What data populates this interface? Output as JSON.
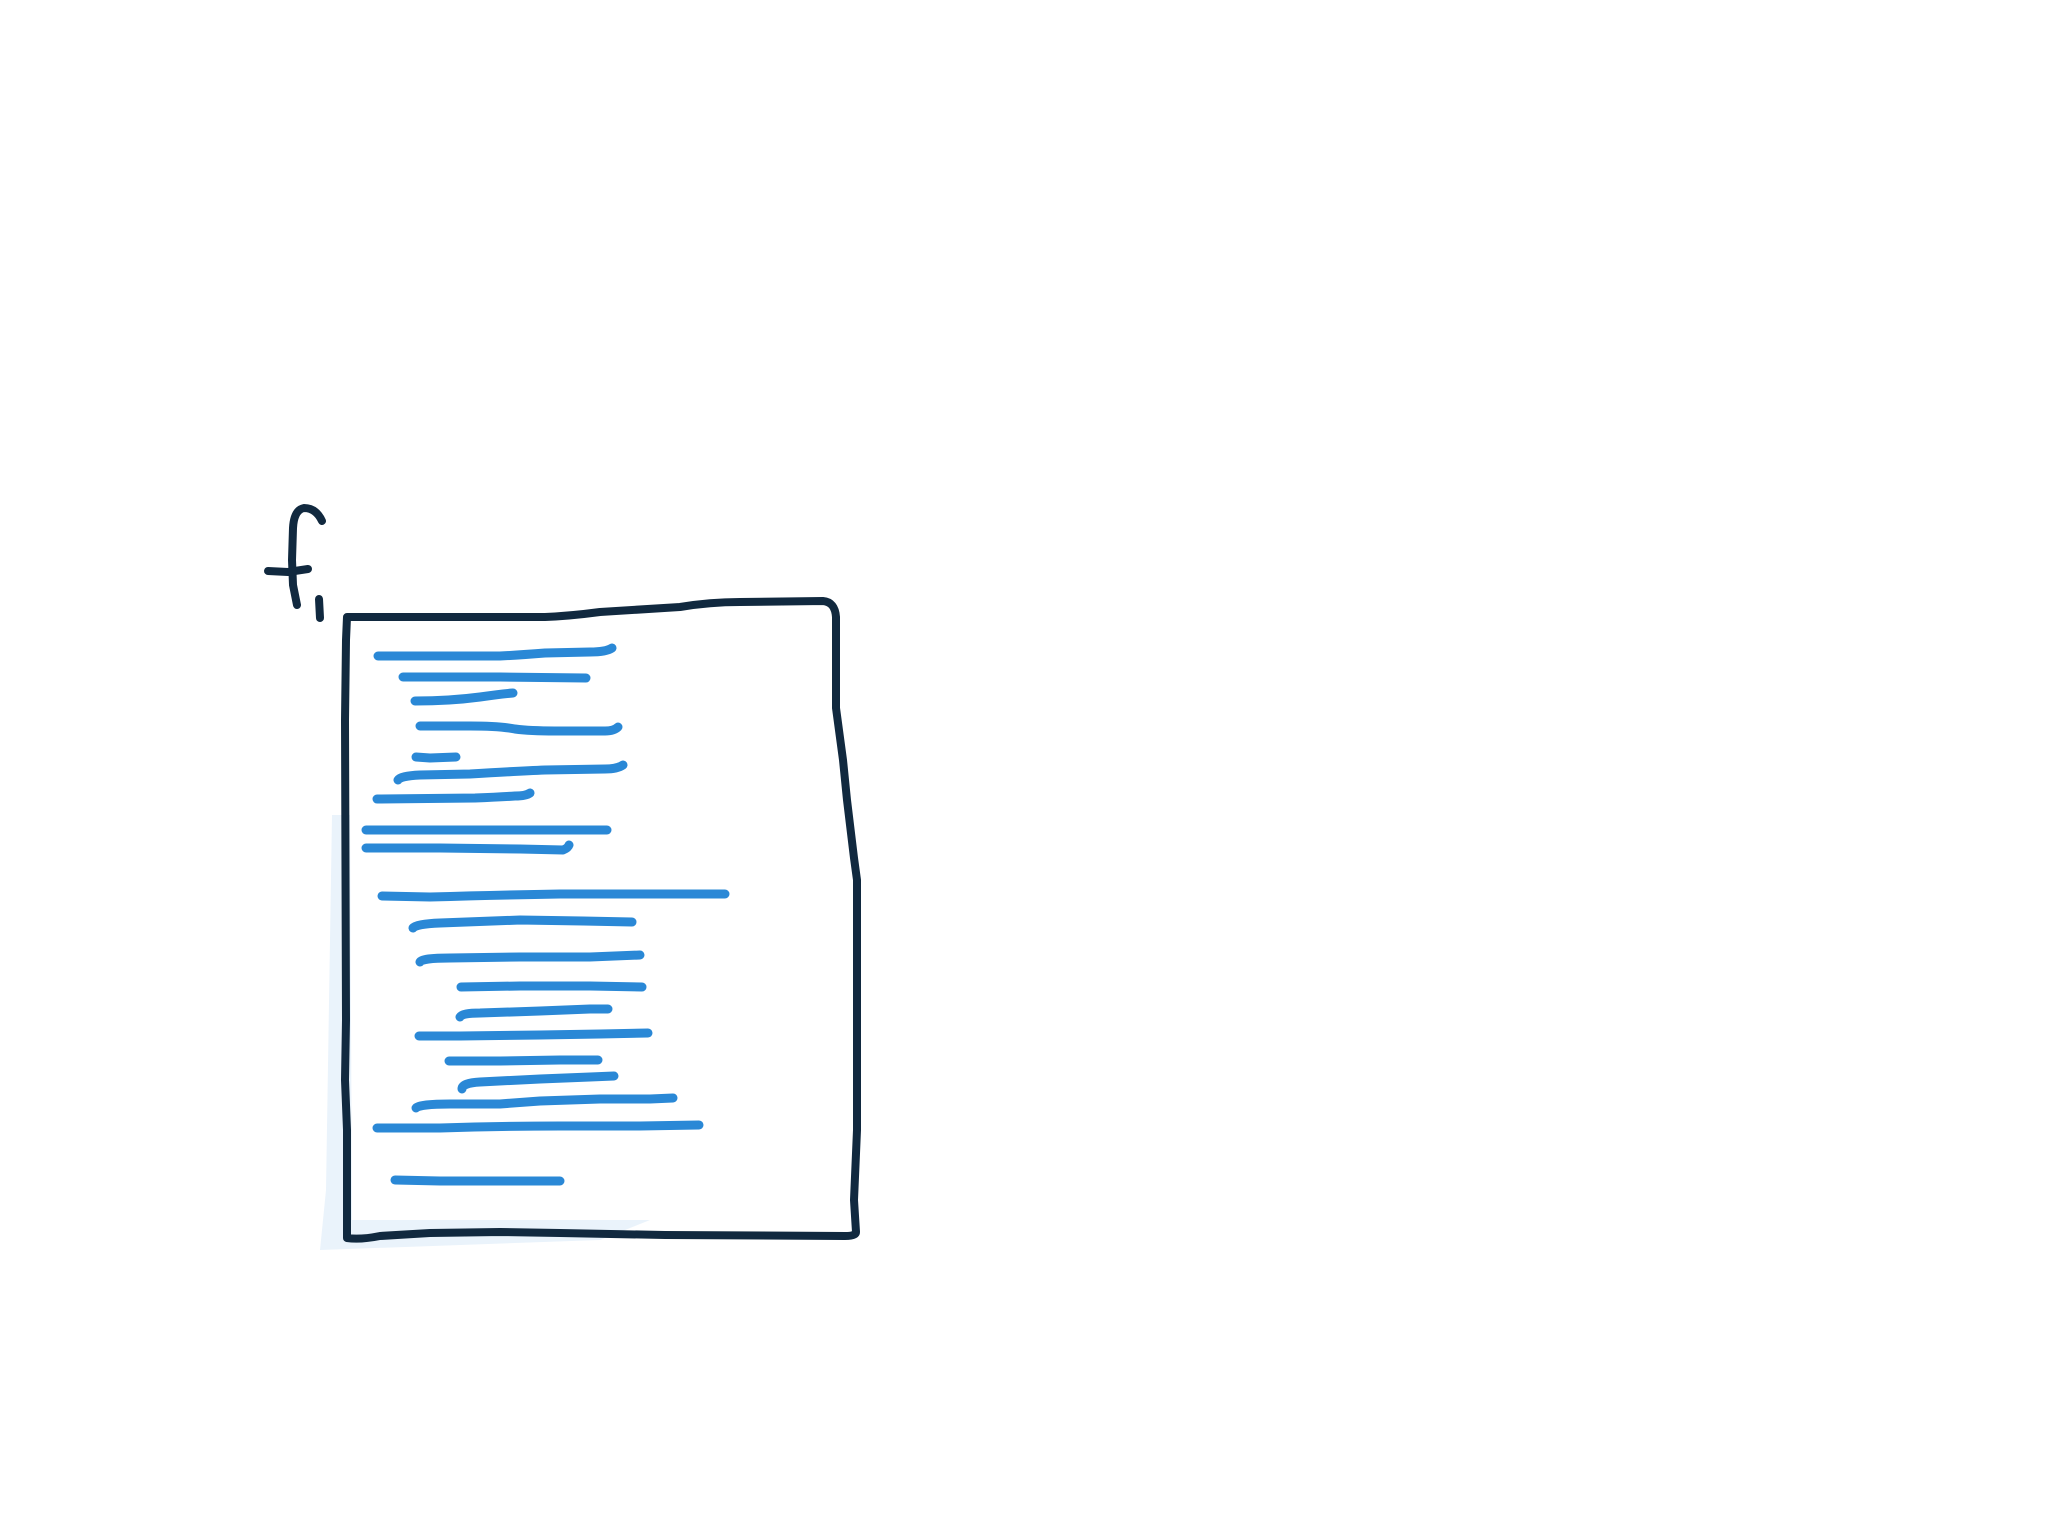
{
  "file": {
    "label": "f",
    "subscript": "1",
    "stroke_color": "#11293f",
    "shadow_color": "#eaf3fb"
  },
  "text_lines": {
    "color": "#2a88d6",
    "count": 23
  }
}
